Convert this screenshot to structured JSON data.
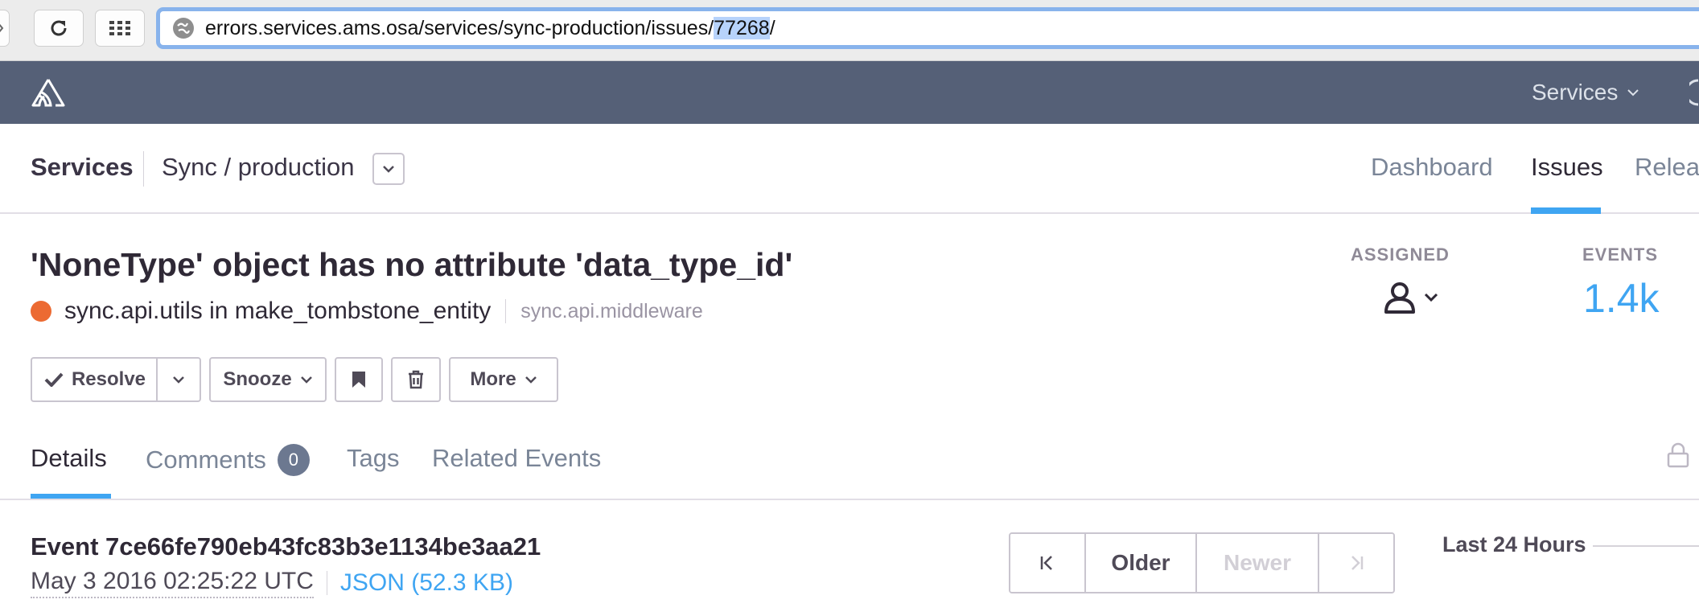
{
  "browser": {
    "url_prefix": "errors.services.ams.osa/services/sync-production/issues/",
    "url_highlight": "77268",
    "url_suffix": "/"
  },
  "topbar": {
    "menu_label": "Services"
  },
  "project_bar": {
    "org": "Services",
    "project": "Sync / production",
    "tabs": [
      {
        "label": "Dashboard",
        "active": false
      },
      {
        "label": "Issues",
        "active": true
      },
      {
        "label": "Releases",
        "active": false
      }
    ]
  },
  "issue": {
    "title": "'NoneType' object has no attribute 'data_type_id'",
    "culprit": "sync.api.utils in make_tombstone_entity",
    "sub_culprit": "sync.api.middleware",
    "level_color": "#ec6a32",
    "assigned_label": "ASSIGNED",
    "events_label": "EVENTS",
    "events_count": "1.4k"
  },
  "actions": {
    "resolve": "Resolve",
    "snooze": "Snooze",
    "more": "More"
  },
  "detail_tabs": {
    "details": "Details",
    "comments": "Comments",
    "comments_count": "0",
    "tags": "Tags",
    "related": "Related Events"
  },
  "event": {
    "id_line": "Event 7ce66fe790eb43fc83b3e1134be3aa21",
    "date": "May 3 2016 02:25:22 UTC",
    "json_link": "JSON (52.3 KB)",
    "pager": {
      "older": "Older",
      "newer": "Newer"
    },
    "range_label": "Last 24 Hours"
  },
  "colors": {
    "accent": "#3fa5f2",
    "header_bg": "#556077"
  }
}
